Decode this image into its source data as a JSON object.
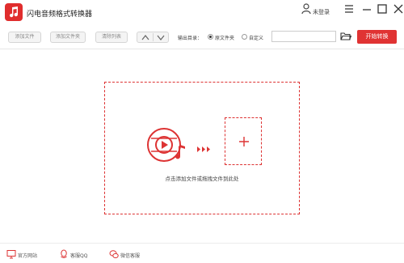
{
  "app": {
    "title": "闪电音频格式转换器"
  },
  "user": {
    "login_label": "未登录"
  },
  "toolbar": {
    "add_file": "添加文件",
    "add_folder": "添加文件夹",
    "clear_list": "清除列表",
    "output_dir_label": "输出目录：",
    "option_source": "原文件夹",
    "option_custom": "自定义",
    "output_path_value": "",
    "start_button": "开始转换"
  },
  "dropzone": {
    "hint": "点击添加文件或拖拽文件到此处"
  },
  "footer": {
    "website": "官方网站",
    "qq": "客服QQ",
    "wechat": "微信客服"
  },
  "colors": {
    "accent": "#e03333",
    "dropzone_border": "#d33333"
  }
}
